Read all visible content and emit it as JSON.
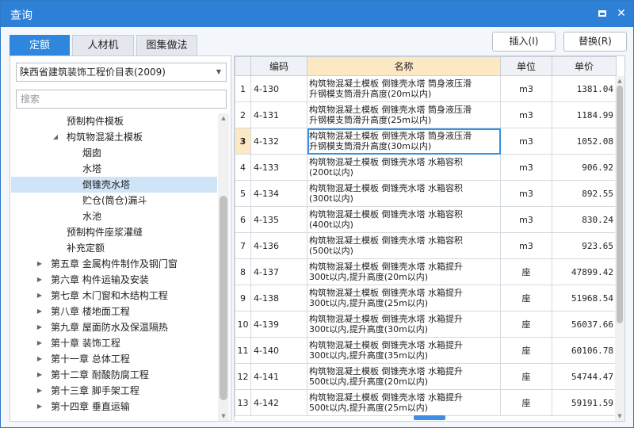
{
  "window": {
    "title": "查询"
  },
  "tabs": [
    {
      "label": "定额",
      "active": true
    },
    {
      "label": "人材机",
      "active": false
    },
    {
      "label": "图集做法",
      "active": false
    }
  ],
  "actions": {
    "insert_label": "插入(I)",
    "replace_label": "替换(R)"
  },
  "left": {
    "catalog_value": "陕西省建筑装饰工程价目表(2009)",
    "search_placeholder": "搜索",
    "tree": [
      {
        "label": "预制构件模板",
        "level": 2,
        "arrow": ""
      },
      {
        "label": "构筑物混凝土模板",
        "level": 2,
        "arrow": "down"
      },
      {
        "label": "烟囱",
        "level": 3,
        "arrow": ""
      },
      {
        "label": "水塔",
        "level": 3,
        "arrow": ""
      },
      {
        "label": "倒锥壳水塔",
        "level": 3,
        "arrow": "",
        "selected": true
      },
      {
        "label": "贮仓(筒仓)漏斗",
        "level": 3,
        "arrow": ""
      },
      {
        "label": "水池",
        "level": 3,
        "arrow": ""
      },
      {
        "label": "预制构件座浆灌缝",
        "level": 2,
        "arrow": ""
      },
      {
        "label": "补充定额",
        "level": 2,
        "arrow": ""
      },
      {
        "label": "第五章 金属构件制作及钢门窗",
        "level": 1,
        "arrow": "right"
      },
      {
        "label": "第六章 构件运输及安装",
        "level": 1,
        "arrow": "right"
      },
      {
        "label": "第七章 木门窗和木结构工程",
        "level": 1,
        "arrow": "right"
      },
      {
        "label": "第八章 楼地面工程",
        "level": 1,
        "arrow": "right"
      },
      {
        "label": "第九章 屋面防水及保温隔热",
        "level": 1,
        "arrow": "right"
      },
      {
        "label": "第十章 装饰工程",
        "level": 1,
        "arrow": "right"
      },
      {
        "label": "第十一章 总体工程",
        "level": 1,
        "arrow": "right"
      },
      {
        "label": "第十二章 耐酸防腐工程",
        "level": 1,
        "arrow": "right"
      },
      {
        "label": "第十三章 脚手架工程",
        "level": 1,
        "arrow": "right"
      },
      {
        "label": "第十四章 垂直运输",
        "level": 1,
        "arrow": "right"
      }
    ]
  },
  "grid": {
    "columns": [
      "",
      "编码",
      "名称",
      "单位",
      "单价"
    ],
    "current_row": 3,
    "rows": [
      {
        "n": "1",
        "code": "4-130",
        "name1": "构筑物混凝土模板 倒锥壳水塔 筒身液压滑",
        "name2": "升钢模支筒滑升高度(20m以内)",
        "unit": "m3",
        "price": "1381.04"
      },
      {
        "n": "2",
        "code": "4-131",
        "name1": "构筑物混凝土模板 倒锥壳水塔 筒身液压滑",
        "name2": "升钢模支筒滑升高度(25m以内)",
        "unit": "m3",
        "price": "1184.99"
      },
      {
        "n": "3",
        "code": "4-132",
        "name1": "构筑物混凝土模板 倒锥壳水塔 筒身液压滑",
        "name2": "升钢模支筒滑升高度(30m以内)",
        "unit": "m3",
        "price": "1052.08"
      },
      {
        "n": "4",
        "code": "4-133",
        "name1": "构筑物混凝土模板 倒锥壳水塔 水箱容积",
        "name2": "(200t以内)",
        "unit": "m3",
        "price": "906.92"
      },
      {
        "n": "5",
        "code": "4-134",
        "name1": "构筑物混凝土模板 倒锥壳水塔 水箱容积",
        "name2": "(300t以内)",
        "unit": "m3",
        "price": "892.55"
      },
      {
        "n": "6",
        "code": "4-135",
        "name1": "构筑物混凝土模板 倒锥壳水塔 水箱容积",
        "name2": "(400t以内)",
        "unit": "m3",
        "price": "830.24"
      },
      {
        "n": "7",
        "code": "4-136",
        "name1": "构筑物混凝土模板 倒锥壳水塔 水箱容积",
        "name2": "(500t以内)",
        "unit": "m3",
        "price": "923.65"
      },
      {
        "n": "8",
        "code": "4-137",
        "name1": "构筑物混凝土模板 倒锥壳水塔 水箱提升",
        "name2": "300t以内,提升高度(20m以内)",
        "unit": "座",
        "price": "47899.42"
      },
      {
        "n": "9",
        "code": "4-138",
        "name1": "构筑物混凝土模板 倒锥壳水塔 水箱提升",
        "name2": "300t以内,提升高度(25m以内)",
        "unit": "座",
        "price": "51968.54"
      },
      {
        "n": "10",
        "code": "4-139",
        "name1": "构筑物混凝土模板 倒锥壳水塔 水箱提升",
        "name2": "300t以内,提升高度(30m以内)",
        "unit": "座",
        "price": "56037.66"
      },
      {
        "n": "11",
        "code": "4-140",
        "name1": "构筑物混凝土模板 倒锥壳水塔 水箱提升",
        "name2": "300t以内,提升高度(35m以内)",
        "unit": "座",
        "price": "60106.78"
      },
      {
        "n": "12",
        "code": "4-141",
        "name1": "构筑物混凝土模板 倒锥壳水塔 水箱提升",
        "name2": "500t以内,提升高度(20m以内)",
        "unit": "座",
        "price": "54744.47"
      },
      {
        "n": "13",
        "code": "4-142",
        "name1": "构筑物混凝土模板 倒锥壳水塔 水箱提升",
        "name2": "500t以内,提升高度(25m以内)",
        "unit": "座",
        "price": "59191.59"
      }
    ]
  }
}
